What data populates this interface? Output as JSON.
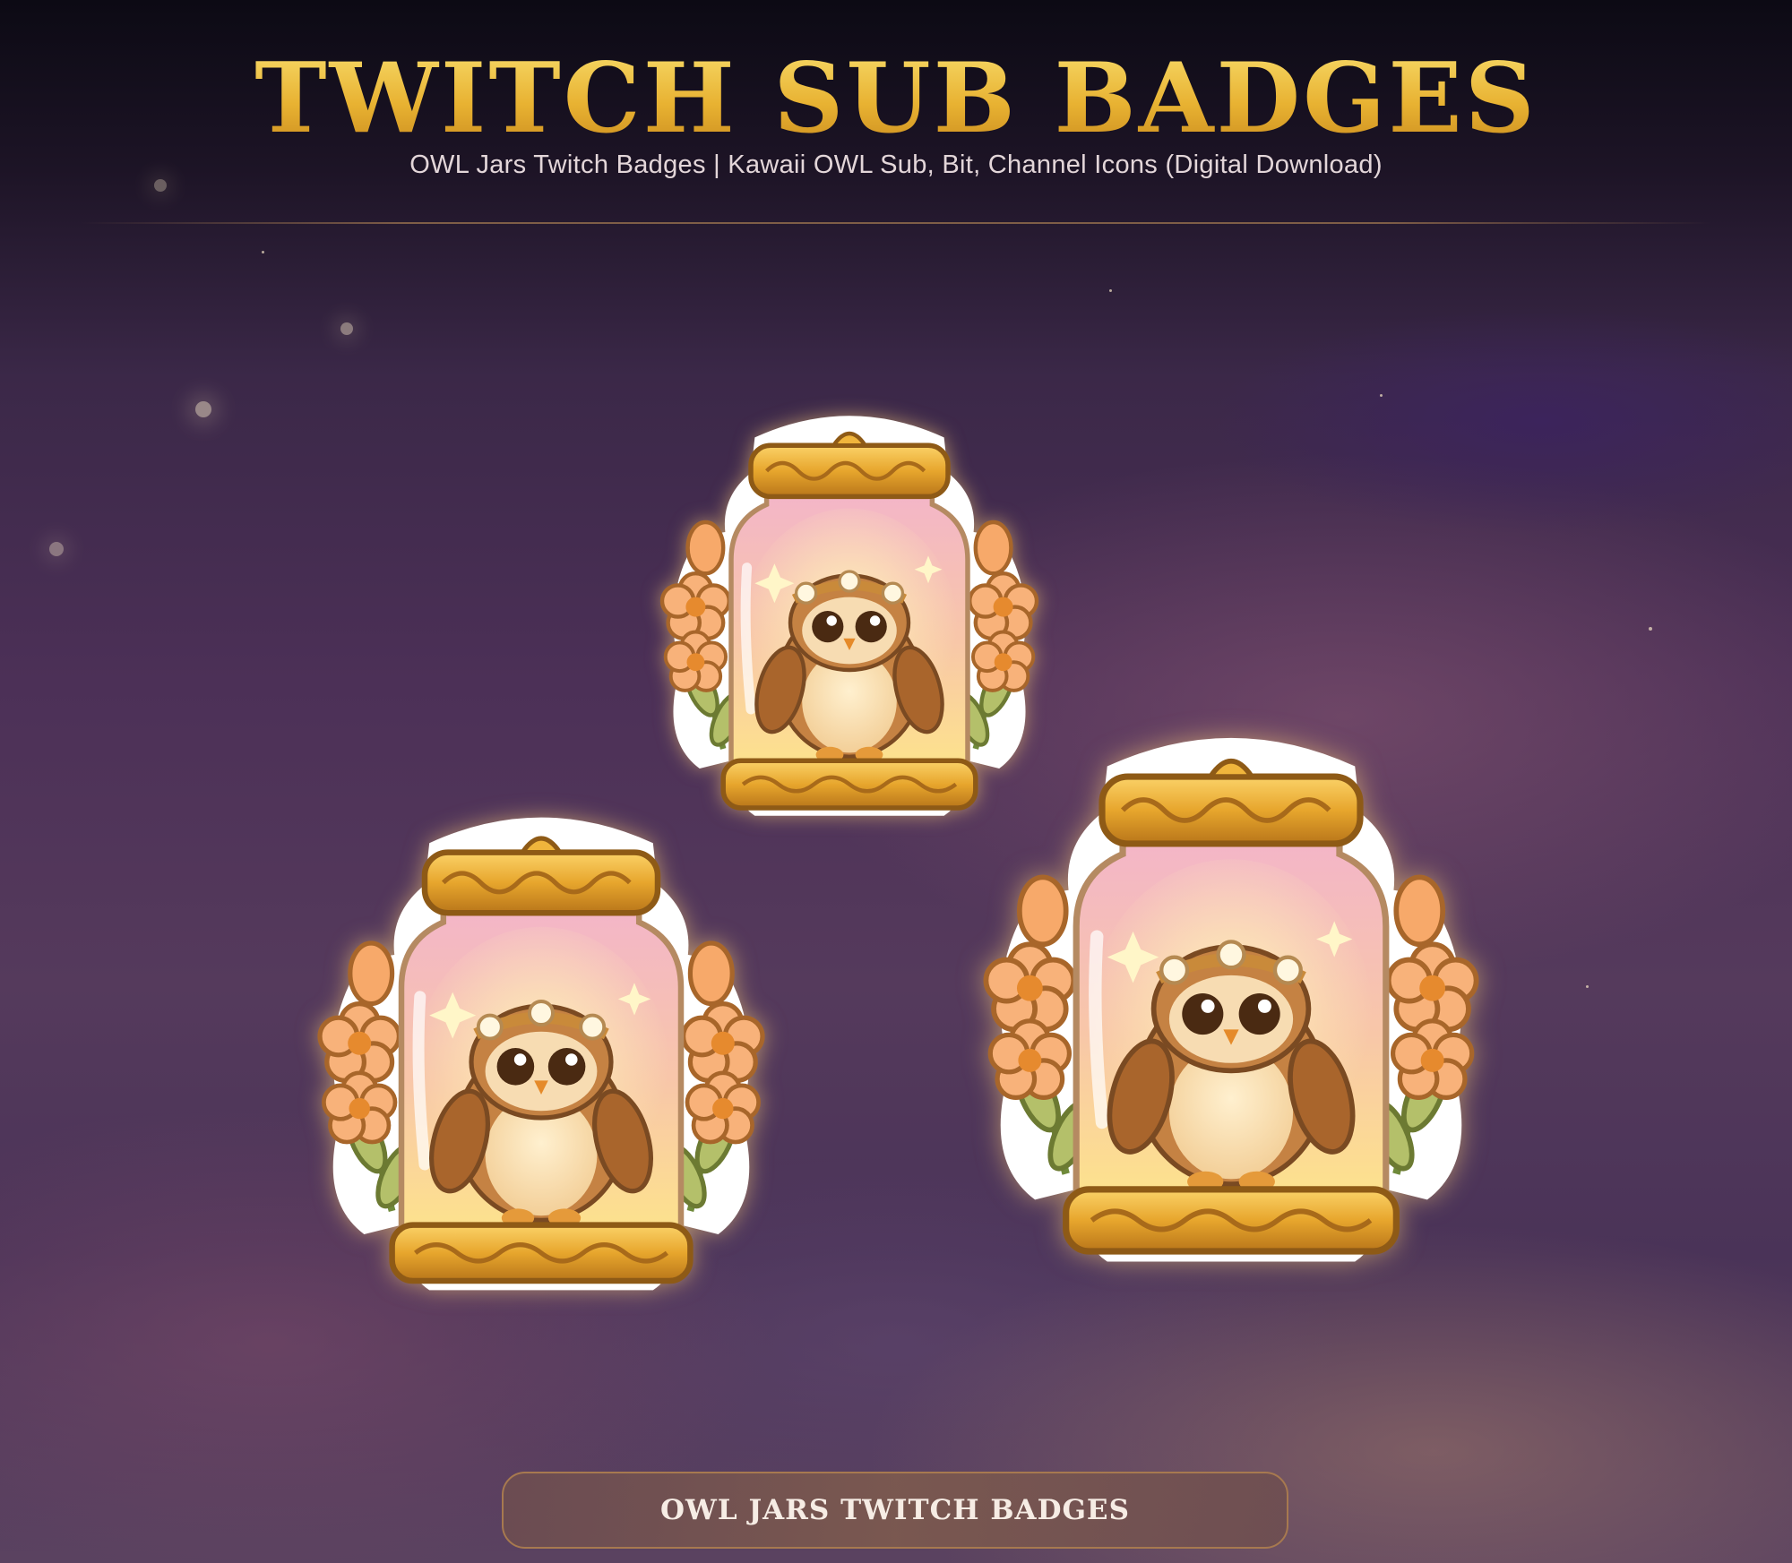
{
  "header": {
    "title": "TWITCH SUB BADGES",
    "subtitle": "OWL Jars Twitch Badges | Kawaii OWL Sub, Bit, Channel Icons (Digital Download)"
  },
  "badges": [
    {
      "name": "owl-jar-badge",
      "icon": "owl-jar-icon"
    },
    {
      "name": "owl-jar-badge",
      "icon": "owl-jar-icon"
    },
    {
      "name": "owl-jar-badge",
      "icon": "owl-jar-icon"
    }
  ],
  "footer": {
    "button_label": "OWL JARS TWITCH BADGES"
  },
  "colors": {
    "title_gold": "#e8b232",
    "background_purple": "#4c3057",
    "button_border": "#a7794f"
  }
}
